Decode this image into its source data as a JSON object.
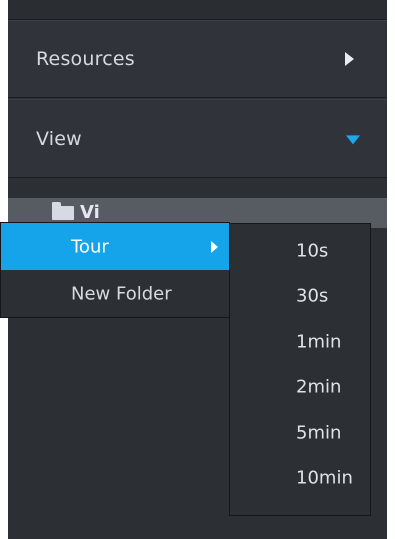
{
  "sidebar": {
    "sections": [
      {
        "label": "Resources",
        "expanded": false,
        "arrow_icon": "chevron-right-icon"
      },
      {
        "label": "View",
        "expanded": true,
        "arrow_icon": "chevron-down-icon",
        "arrow_color": "#19a9ec"
      }
    ],
    "tree_item": {
      "icon": "folder-icon",
      "label_visible_fragment": "Vi"
    }
  },
  "context_menu": {
    "items": [
      {
        "label": "Tour",
        "active": true,
        "has_submenu": true
      },
      {
        "label": "New Folder",
        "active": false,
        "has_submenu": false
      }
    ],
    "active_color": "#15a4ea"
  },
  "submenu": {
    "items": [
      "10s",
      "30s",
      "1min",
      "2min",
      "5min",
      "10min"
    ]
  }
}
